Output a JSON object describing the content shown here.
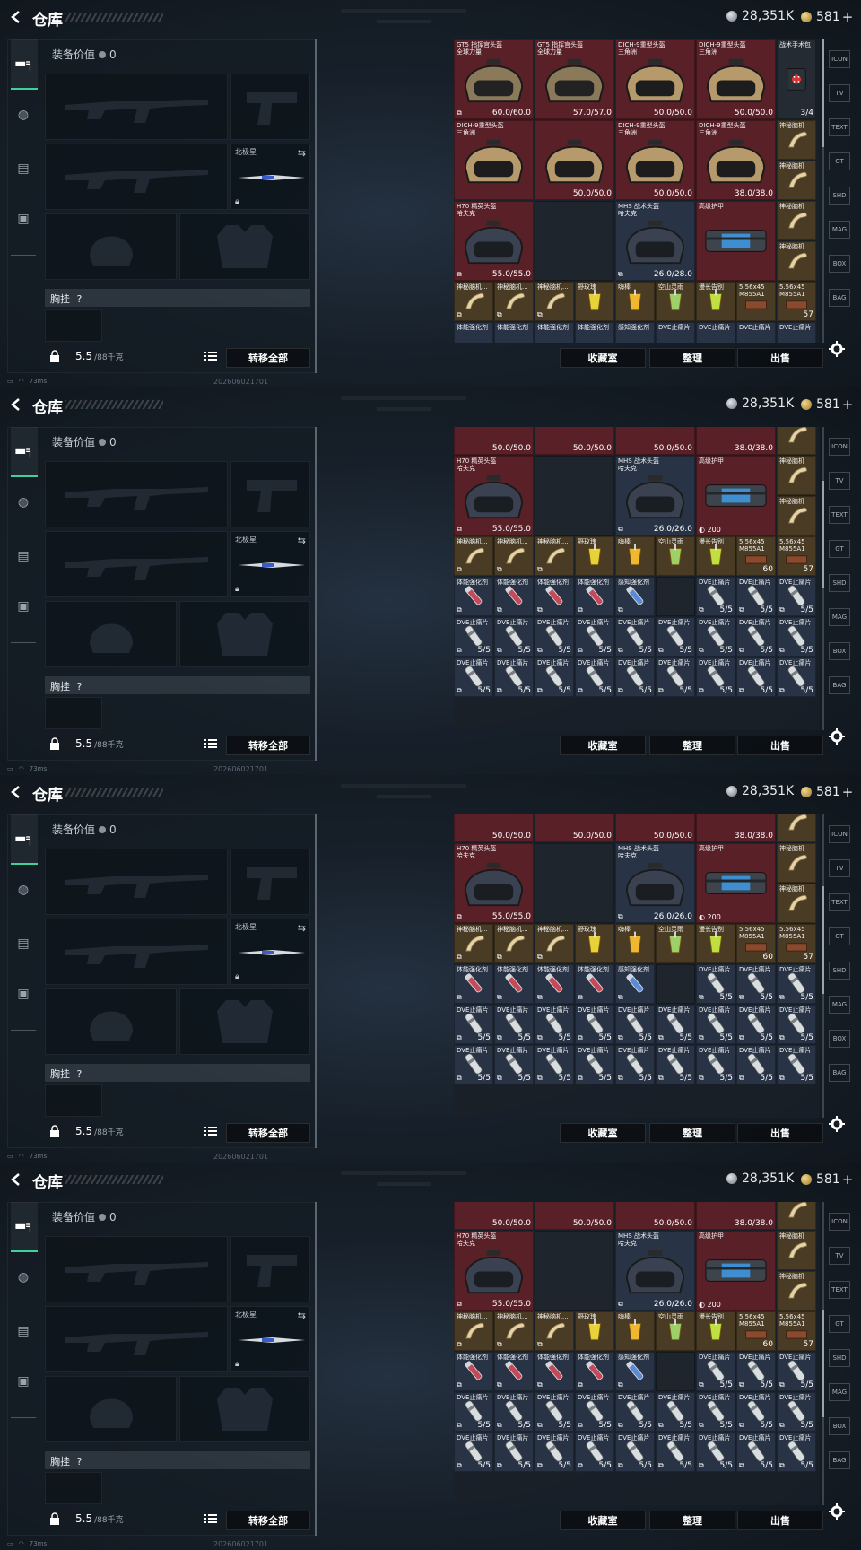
{
  "header": {
    "title": "仓库",
    "silver": "28,351K",
    "gold": "581",
    "gold_plus": "+"
  },
  "loadout": {
    "equip_value_label": "装备价值",
    "equip_value": "0",
    "pistol_slot_label": "北极星",
    "chest_label": "胸挂",
    "chest_help": "?",
    "weight": "5.5",
    "weight_max": "/88千克",
    "transfer_all": "转移全部"
  },
  "actions": {
    "collection": "收藏室",
    "sort": "整理",
    "sell": "出售"
  },
  "status": {
    "ping": "73ms",
    "build": "20260602170­1"
  },
  "rail": [
    "ICON",
    "TV",
    "TEXT",
    "GT",
    "SHD",
    "MAG",
    "BOX",
    "BAG"
  ],
  "items": [
    {
      "name": "GT5 指挥官头盔\n全球力量",
      "qty": "60.0/60.0",
      "color": "red",
      "art": "helmet-tan",
      "tag": "⧉"
    },
    {
      "name": "GT5 指挥官头盔\n全球力量",
      "qty": "57.0/57.0",
      "color": "red",
      "art": "helmet-tan",
      "tag": "⧉"
    },
    {
      "name": "DICH-9重型头盔\n三角洲",
      "qty": "50.0/50.0",
      "color": "red",
      "art": "helmet-tan2",
      "tag": ""
    },
    {
      "name": "DICH-9重型头盔\n三角洲",
      "qty": "50.0/50.0",
      "color": "red",
      "art": "helmet-tan2",
      "tag": ""
    },
    {
      "name": "战术手术包",
      "qty": "3/4",
      "color": "dark",
      "art": "medkit",
      "tag": ""
    },
    {
      "name": "DICH-9重型头盔\n三角洲",
      "qty": "",
      "color": "red",
      "art": "helmet-tan2",
      "tag": ""
    },
    {
      "name": "DICH-9重型头盔\n三角洲",
      "qty": "",
      "color": "red",
      "art": "helmet-tan2",
      "tag": ""
    },
    {
      "name": "DICH-9重型头盔\n三角洲",
      "qty": "50.0/50.0",
      "color": "red",
      "art": "helmet-tan2",
      "tag": ""
    },
    {
      "name": "DICH-9重型头盔\n三角洲",
      "qty": "38.0/38.0",
      "color": "red",
      "art": "helmet-tan2",
      "tag": ""
    },
    {
      "name": "神秘脑机",
      "qty": "",
      "color": "gold",
      "art": "bone",
      "tag": ""
    }
  ],
  "panels": [
    {
      "id": "p1",
      "top_label": ""
    },
    {
      "id": "p2",
      "top_label": ""
    },
    {
      "id": "p3",
      "top_label": ""
    },
    {
      "id": "p4",
      "top_label": ""
    }
  ],
  "labels": {
    "h70": "H70 精英头盔\n哈夫克",
    "h70_qty": "55.0/55.0",
    "mhs": "MHS 战术头盔\n哈夫克",
    "mhs_qty": "26.0/28.0",
    "mhs_qty2": "26.0/26.0",
    "armor": "高级护甲",
    "armor_qty": "200",
    "brain": "神秘脑机",
    "brain_short": "神秘脑机...",
    "rose": "野玫瑰",
    "chiba": "嗨棒",
    "kongshan": "空山灵雨",
    "manchang": "漫长告别",
    "ammo": "5.56x45\nM855A1",
    "ammo_q1": "60",
    "ammo_q2": "57",
    "stim": "体能强化剂",
    "sense": "感知强化剂",
    "dve": "DVE止痛片",
    "dve_qty": "5/5",
    "top_q1": "50.0/50.0",
    "top_q2": "50.0/50.0",
    "top_q3": "38.0/38.0",
    "top_q4": "60.0/60.0",
    "top_q5": "57.0/57.0",
    "gt5": "GT5 指挥官头盔\n全球力量",
    "dich": "DICH-9重型头盔\n三角洲",
    "medkit": "战术手术包",
    "medkit_qty": "3/4"
  }
}
